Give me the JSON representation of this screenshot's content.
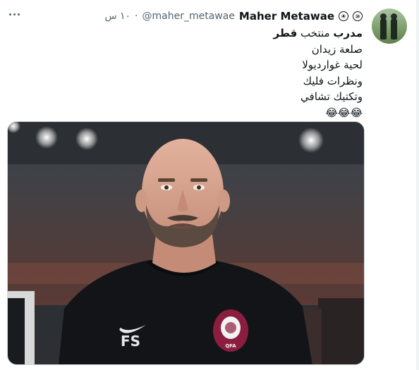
{
  "tweet": {
    "author": {
      "name": "Maher Metawae",
      "handle": "@maher_metawae",
      "badges": [
        "④",
        "⑩"
      ]
    },
    "separator": "·",
    "time": "١٠ س",
    "text_lines": [
      {
        "bold": "مدرب",
        "rest": " منتخب ",
        "bold2": "قطر"
      },
      {
        "text": "صلعة زيدان"
      },
      {
        "text": "لحية غوارديولا"
      },
      {
        "text": "ونظرات فليك"
      },
      {
        "text": "وتكتيك تشافي"
      },
      {
        "text": "😂😂😂"
      }
    ],
    "media": {
      "alt": "",
      "shirt_initials": "FS",
      "crest_text": "QFA"
    }
  },
  "colors": {
    "text": "#0f1419",
    "secondary": "#536471",
    "border": "#cfd9de",
    "shirt": "#121418"
  },
  "icons": [
    "more-options-icon",
    "verified-badge-icon",
    "nike-swoosh-icon",
    "qatar-crest-icon"
  ]
}
